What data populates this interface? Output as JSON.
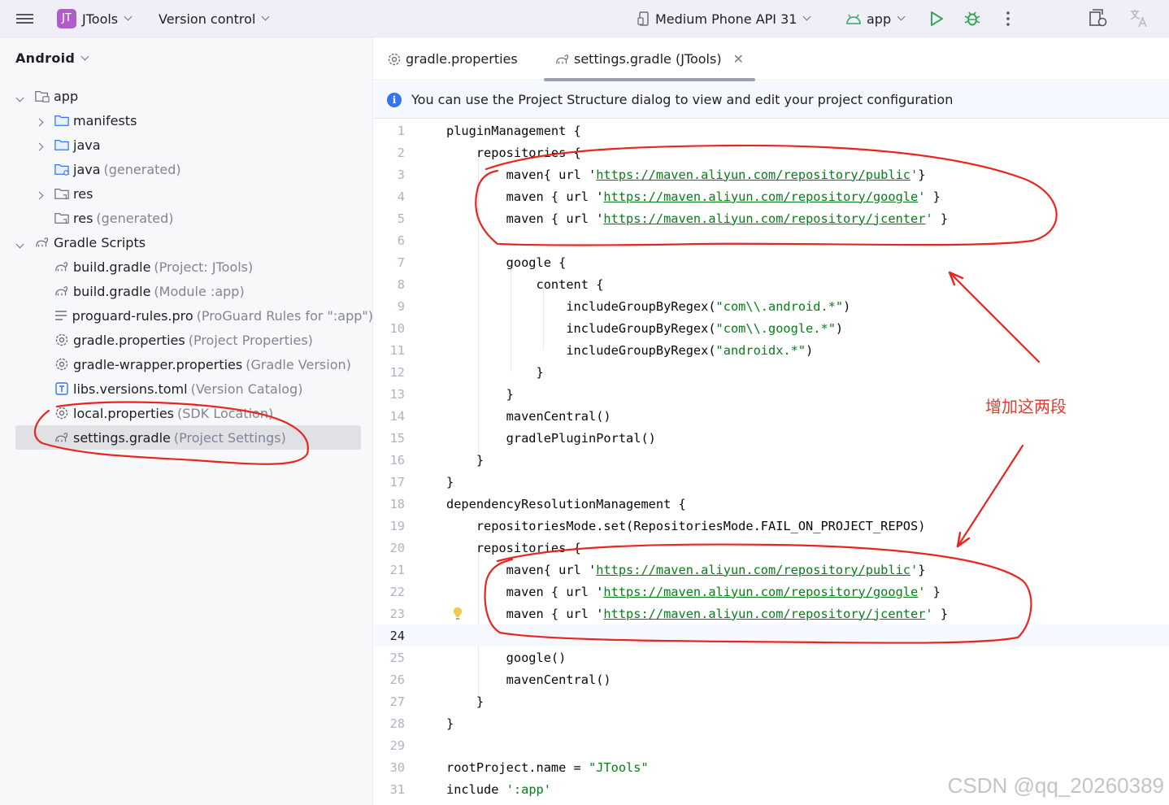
{
  "toolbar": {
    "project_badge": "JT",
    "project_name": "JTools",
    "vcs_label": "Version control",
    "device_label": "Medium Phone API 31",
    "run_config": "app"
  },
  "project_panel": {
    "view_label": "Android",
    "items": [
      {
        "label": "app",
        "hint": ""
      },
      {
        "label": "manifests",
        "hint": ""
      },
      {
        "label": "java",
        "hint": ""
      },
      {
        "label": "java",
        "hint": "(generated)"
      },
      {
        "label": "res",
        "hint": ""
      },
      {
        "label": "res",
        "hint": "(generated)"
      },
      {
        "label": "Gradle Scripts",
        "hint": ""
      },
      {
        "label": "build.gradle",
        "hint": "(Project: JTools)"
      },
      {
        "label": "build.gradle",
        "hint": "(Module :app)"
      },
      {
        "label": "proguard-rules.pro",
        "hint": "(ProGuard Rules for \":app\")"
      },
      {
        "label": "gradle.properties",
        "hint": "(Project Properties)"
      },
      {
        "label": "gradle-wrapper.properties",
        "hint": "(Gradle Version)"
      },
      {
        "label": "libs.versions.toml",
        "hint": "(Version Catalog)"
      },
      {
        "label": "local.properties",
        "hint": "(SDK Location)"
      },
      {
        "label": "settings.gradle",
        "hint": "(Project Settings)"
      }
    ]
  },
  "editor": {
    "tabs": [
      {
        "label": "gradle.properties"
      },
      {
        "label": "settings.gradle (JTools)"
      }
    ],
    "banner": "You can use the Project Structure dialog to view and edit your project configuration",
    "lines": [
      {
        "n": "1",
        "parts": [
          {
            "t": "pluginManagement {"
          }
        ]
      },
      {
        "n": "2",
        "parts": [
          {
            "t": "    repositories {"
          }
        ]
      },
      {
        "n": "3",
        "parts": [
          {
            "t": "        maven{ url '"
          },
          {
            "t": "https://maven.aliyun.com/repository/public",
            "c": "url"
          },
          {
            "t": "'",
            "c": "str"
          },
          {
            "t": "}"
          }
        ]
      },
      {
        "n": "4",
        "parts": [
          {
            "t": "        maven { url '"
          },
          {
            "t": "https://maven.aliyun.com/repository/google",
            "c": "url"
          },
          {
            "t": "'",
            "c": "str"
          },
          {
            "t": " }"
          }
        ]
      },
      {
        "n": "5",
        "parts": [
          {
            "t": "        maven { url '"
          },
          {
            "t": "https://maven.aliyun.com/repository/jcenter",
            "c": "url"
          },
          {
            "t": "'",
            "c": "str"
          },
          {
            "t": " }"
          }
        ]
      },
      {
        "n": "6",
        "parts": [
          {
            "t": ""
          }
        ]
      },
      {
        "n": "7",
        "parts": [
          {
            "t": "        google {"
          }
        ]
      },
      {
        "n": "8",
        "parts": [
          {
            "t": "            content {"
          }
        ]
      },
      {
        "n": "9",
        "parts": [
          {
            "t": "                includeGroupByRegex("
          },
          {
            "t": "\"com\\\\.android.*\"",
            "c": "str"
          },
          {
            "t": ")"
          }
        ]
      },
      {
        "n": "10",
        "parts": [
          {
            "t": "                includeGroupByRegex("
          },
          {
            "t": "\"com\\\\.google.*\"",
            "c": "str"
          },
          {
            "t": ")"
          }
        ]
      },
      {
        "n": "11",
        "parts": [
          {
            "t": "                includeGroupByRegex("
          },
          {
            "t": "\"androidx.*\"",
            "c": "str"
          },
          {
            "t": ")"
          }
        ]
      },
      {
        "n": "12",
        "parts": [
          {
            "t": "            }"
          }
        ]
      },
      {
        "n": "13",
        "parts": [
          {
            "t": "        }"
          }
        ]
      },
      {
        "n": "14",
        "parts": [
          {
            "t": "        mavenCentral()"
          }
        ]
      },
      {
        "n": "15",
        "parts": [
          {
            "t": "        gradlePluginPortal()"
          }
        ]
      },
      {
        "n": "16",
        "parts": [
          {
            "t": "    }"
          }
        ]
      },
      {
        "n": "17",
        "parts": [
          {
            "t": "}"
          }
        ]
      },
      {
        "n": "18",
        "parts": [
          {
            "t": "dependencyResolutionManagement {"
          }
        ]
      },
      {
        "n": "19",
        "parts": [
          {
            "t": "    repositoriesMode.set(RepositoriesMode.FAIL_ON_PROJECT_REPOS)"
          }
        ]
      },
      {
        "n": "20",
        "parts": [
          {
            "t": "    repositories {"
          }
        ]
      },
      {
        "n": "21",
        "parts": [
          {
            "t": "        maven{ url '"
          },
          {
            "t": "https://maven.aliyun.com/repository/public",
            "c": "url"
          },
          {
            "t": "'",
            "c": "str"
          },
          {
            "t": "}"
          }
        ]
      },
      {
        "n": "22",
        "parts": [
          {
            "t": "        maven { url '"
          },
          {
            "t": "https://maven.aliyun.com/repository/google",
            "c": "url"
          },
          {
            "t": "'",
            "c": "str"
          },
          {
            "t": " }"
          }
        ]
      },
      {
        "n": "23",
        "parts": [
          {
            "t": "        maven { url '"
          },
          {
            "t": "https://maven.aliyun.com/repository/jcenter",
            "c": "url"
          },
          {
            "t": "'",
            "c": "str"
          },
          {
            "t": " }"
          }
        ]
      },
      {
        "n": "24",
        "parts": [
          {
            "t": ""
          }
        ]
      },
      {
        "n": "25",
        "parts": [
          {
            "t": "        google()"
          }
        ]
      },
      {
        "n": "26",
        "parts": [
          {
            "t": "        mavenCentral()"
          }
        ]
      },
      {
        "n": "27",
        "parts": [
          {
            "t": "    }"
          }
        ]
      },
      {
        "n": "28",
        "parts": [
          {
            "t": "}"
          }
        ]
      },
      {
        "n": "29",
        "parts": [
          {
            "t": ""
          }
        ]
      },
      {
        "n": "30",
        "parts": [
          {
            "t": "rootProject.name = "
          },
          {
            "t": "\"JTools\"",
            "c": "str"
          }
        ]
      },
      {
        "n": "31",
        "parts": [
          {
            "t": "include "
          },
          {
            "t": "':app'",
            "c": "str"
          }
        ]
      }
    ]
  },
  "annotation": {
    "text": "增加这两段",
    "color": "#e63b2e"
  },
  "watermark": "CSDN @qq_20260389"
}
